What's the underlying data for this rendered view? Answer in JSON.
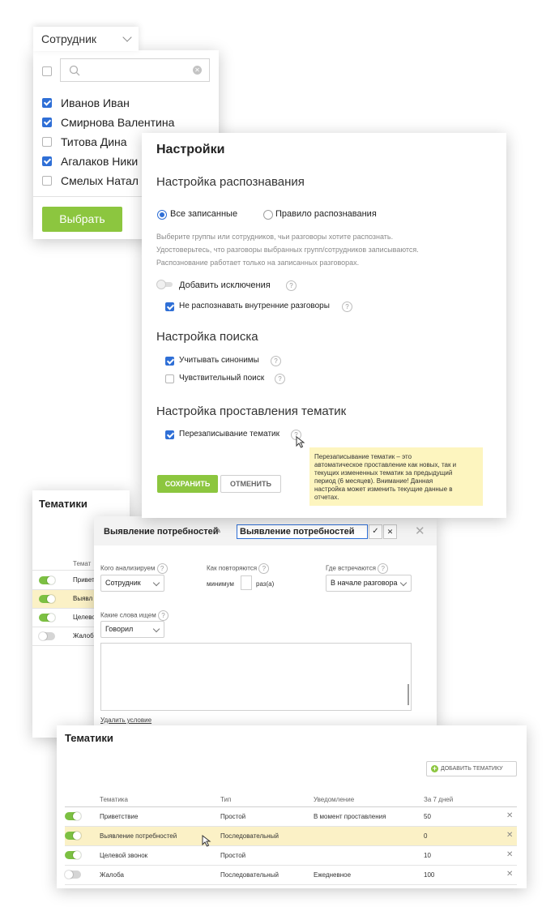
{
  "employee_filter": {
    "dropdown_label": "Сотрудник",
    "search_placeholder": "",
    "people": [
      {
        "name": "Иванов Иван",
        "checked": true
      },
      {
        "name": "Смирнова Валентина",
        "checked": true
      },
      {
        "name": "Титова Дина",
        "checked": false
      },
      {
        "name": "Агалаков Ники",
        "checked": true
      },
      {
        "name": "Смелых Натал",
        "checked": false
      }
    ],
    "select_button": "Выбрать"
  },
  "settings": {
    "title": "Настройки",
    "recognition_heading": "Настройка распознавания",
    "radio_all": "Все записанные",
    "radio_rule": "Правило распознавания",
    "radio_selected": "all",
    "description_lines": [
      "Выберите группы или сотрудников, чьи разговоры хотите распознать.",
      "Удостоверьтесь, что разговоры выбранных групп/сотрудников записываются.",
      "Распознование работает только на записанных разговорах."
    ],
    "add_exceptions": "Добавить исключения",
    "no_internal": "Не распознавать внутренние разговоры",
    "search_heading": "Настройка поиска",
    "synonyms": "Учитывать синонимы",
    "sensitive": "Чувствительный поиск",
    "topics_heading": "Настройка проставления тематик",
    "overwrite": "Перезаписывание тематик",
    "tooltip_lines": [
      "Перезаписывание тематик – это",
      "автоматическое проставление как новых, так и",
      "текущих измененных тематик за предыдущий",
      "период (6 месяцев). Внимание! Данная",
      "настройка может изменить текущие данные в",
      "отчетах."
    ],
    "save": "СОХРАНИТЬ",
    "cancel": "ОТМЕНИТЬ"
  },
  "topics_back": {
    "title": "Тематики",
    "col_partial": "Темат",
    "rows": [
      "Привет",
      "Выявл",
      "Целево",
      "Жалоб"
    ]
  },
  "topic_editor": {
    "title": "Выявление потребностей",
    "edit_value": "Выявление потребностей",
    "who_label": "Кого анализируем",
    "who_value": "Сотрудник",
    "repeat_label": "Как повторяются",
    "min_label": "минимум",
    "times_label": "раз(а)",
    "where_label": "Где встречаются",
    "where_value": "В начале разговора",
    "words_label": "Какие слова ищем",
    "words_value": "Говорил",
    "delete_condition": "Удалить условие"
  },
  "topics_table": {
    "title": "Тематики",
    "add_button": "ДОБАВИТЬ ТЕМАТИКУ",
    "columns": [
      "Тематика",
      "Тип",
      "Уведомление",
      "За 7 дней"
    ],
    "rows": [
      {
        "enabled": true,
        "name": "Приветствие",
        "type": "Простой",
        "notify": "В момент проставления",
        "count": "50"
      },
      {
        "enabled": true,
        "name": "Выявление потребностей",
        "type": "Последовательный",
        "notify": "",
        "count": "0"
      },
      {
        "enabled": true,
        "name": "Целевой звонок",
        "type": "Простой",
        "notify": "",
        "count": "10"
      },
      {
        "enabled": false,
        "name": "Жалоба",
        "type": "Последовательный",
        "notify": "Ежедневное",
        "count": "100"
      }
    ]
  },
  "colors": {
    "green": "#8cc63f",
    "blue": "#2f6fd6",
    "tooltip": "#fdf5bf",
    "highlight": "#fbf1c6"
  }
}
